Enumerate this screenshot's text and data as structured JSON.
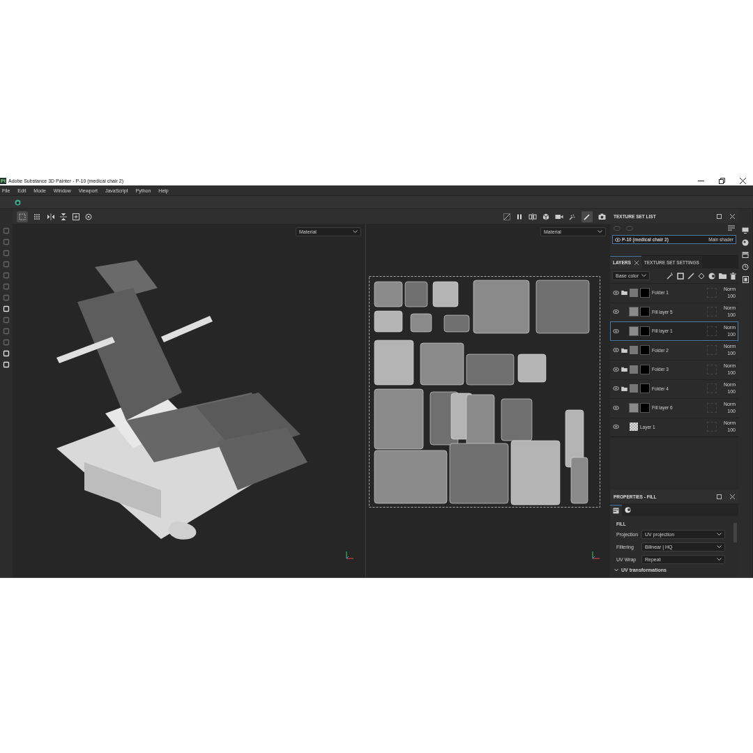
{
  "window": {
    "title": "Adobe Substance 3D Painter - P-10 (medical chair 2)",
    "app_badge": "Pt"
  },
  "menu": [
    "File",
    "Edit",
    "Mode",
    "Window",
    "Viewport",
    "JavaScript",
    "Python",
    "Help"
  ],
  "viewports": [
    {
      "kind": "model",
      "dropdown": "Material"
    },
    {
      "kind": "uv",
      "dropdown": "Material"
    }
  ],
  "texture_set_list": {
    "title": "TEXTURE SET LIST",
    "items": [
      {
        "name": "P-10 (medical chair 2)",
        "shader": "Main shader",
        "selected": true
      }
    ]
  },
  "layer_tabs": [
    {
      "label": "LAYERS",
      "selected": true
    },
    {
      "label": "TEXTURE SET SETTINGS",
      "selected": false
    }
  ],
  "channel_dropdown": "Base color",
  "layers": [
    {
      "name": "Folder 1",
      "kind": "folder",
      "selected": false,
      "blend": "Norm",
      "opacity": "100"
    },
    {
      "name": "Fill layer 5",
      "kind": "fill",
      "selected": false,
      "blend": "Norm",
      "opacity": "100"
    },
    {
      "name": "Fill layer 1",
      "kind": "fill",
      "selected": true,
      "blend": "Norm",
      "opacity": "100"
    },
    {
      "name": "Folder 2",
      "kind": "folder",
      "selected": false,
      "blend": "Norm",
      "opacity": "100"
    },
    {
      "name": "Folder 3",
      "kind": "folder",
      "selected": false,
      "blend": "Norm",
      "opacity": "100"
    },
    {
      "name": "Folder 4",
      "kind": "folder",
      "selected": false,
      "blend": "Norm",
      "opacity": "100"
    },
    {
      "name": "Fill layer 6",
      "kind": "fill",
      "selected": false,
      "blend": "Norm",
      "opacity": "100"
    },
    {
      "name": "Layer 1",
      "kind": "paint",
      "selected": false,
      "blend": "Norm",
      "opacity": "100"
    }
  ],
  "properties": {
    "title": "PROPERTIES - FILL",
    "section": "FILL",
    "fields": [
      {
        "label": "Projection",
        "value": "UV projection"
      },
      {
        "label": "Filtering",
        "value": "Bilinear | HQ"
      },
      {
        "label": "UV Wrap",
        "value": "Repeat"
      }
    ],
    "subsection": {
      "label": "UV transformations",
      "expanded": true
    }
  }
}
